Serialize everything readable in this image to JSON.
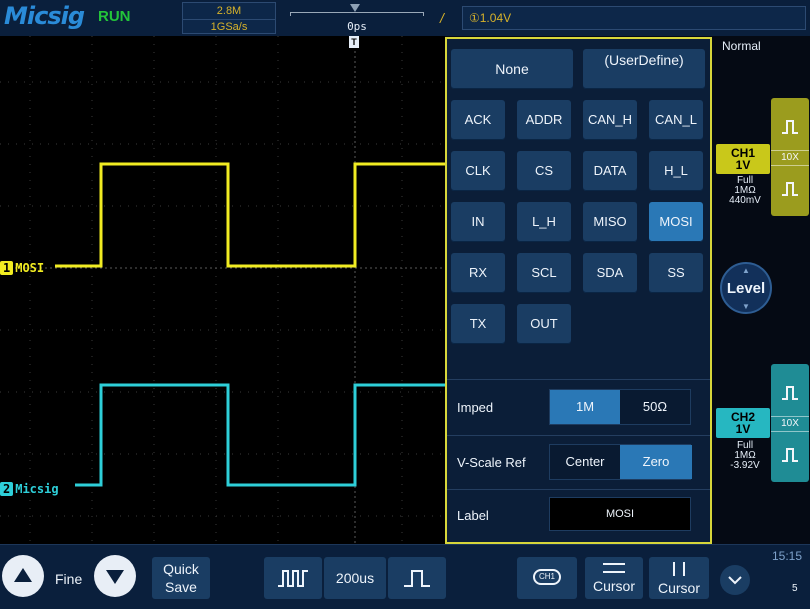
{
  "header": {
    "brand": "Micsig",
    "run_state": "RUN",
    "memory_depth": "2.8M",
    "sample_rate": "1GSa/s",
    "time_offset": "0ps",
    "trigger_level": "①1.04V"
  },
  "channels": {
    "ch1": {
      "tag": "1",
      "label": "MOSI",
      "name": "CH1",
      "scale": "1V",
      "coupling": "Full",
      "impedance": "1MΩ",
      "offset": "440mV",
      "probe": "10X",
      "color": "#f1ec22"
    },
    "ch2": {
      "tag": "2",
      "label": "Micsig",
      "name": "CH2",
      "scale": "1V",
      "coupling": "Full",
      "impedance": "1MΩ",
      "offset": "-3.92V",
      "probe": "10X",
      "color": "#2ecfd9"
    }
  },
  "trigger_mode": "Normal",
  "level_label": "Level",
  "label_panel": {
    "presets_top": [
      "None",
      "(UserDefine)"
    ],
    "presets": [
      "ACK",
      "ADDR",
      "CAN_H",
      "CAN_L",
      "CLK",
      "CS",
      "DATA",
      "H_L",
      "IN",
      "L_H",
      "MISO",
      "MOSI",
      "RX",
      "SCL",
      "SDA",
      "SS",
      "TX",
      "OUT"
    ],
    "selected": "MOSI",
    "imped_label": "Imped",
    "imped_options": [
      "1M",
      "50Ω"
    ],
    "imped_selected": "1M",
    "vscale_label": "V-Scale Ref",
    "vscale_options": [
      "Center",
      "Zero"
    ],
    "vscale_selected": "Zero",
    "label_label": "Label",
    "label_value": "MOSI"
  },
  "bottom": {
    "fine": "Fine",
    "quick_save_1": "Quick",
    "quick_save_2": "Save",
    "timebase": "200us",
    "ch_icon": "CH1",
    "cursor_1": "Cursor",
    "cursor_2": "Cursor",
    "clock": "15:15",
    "clock_sub": "5"
  }
}
